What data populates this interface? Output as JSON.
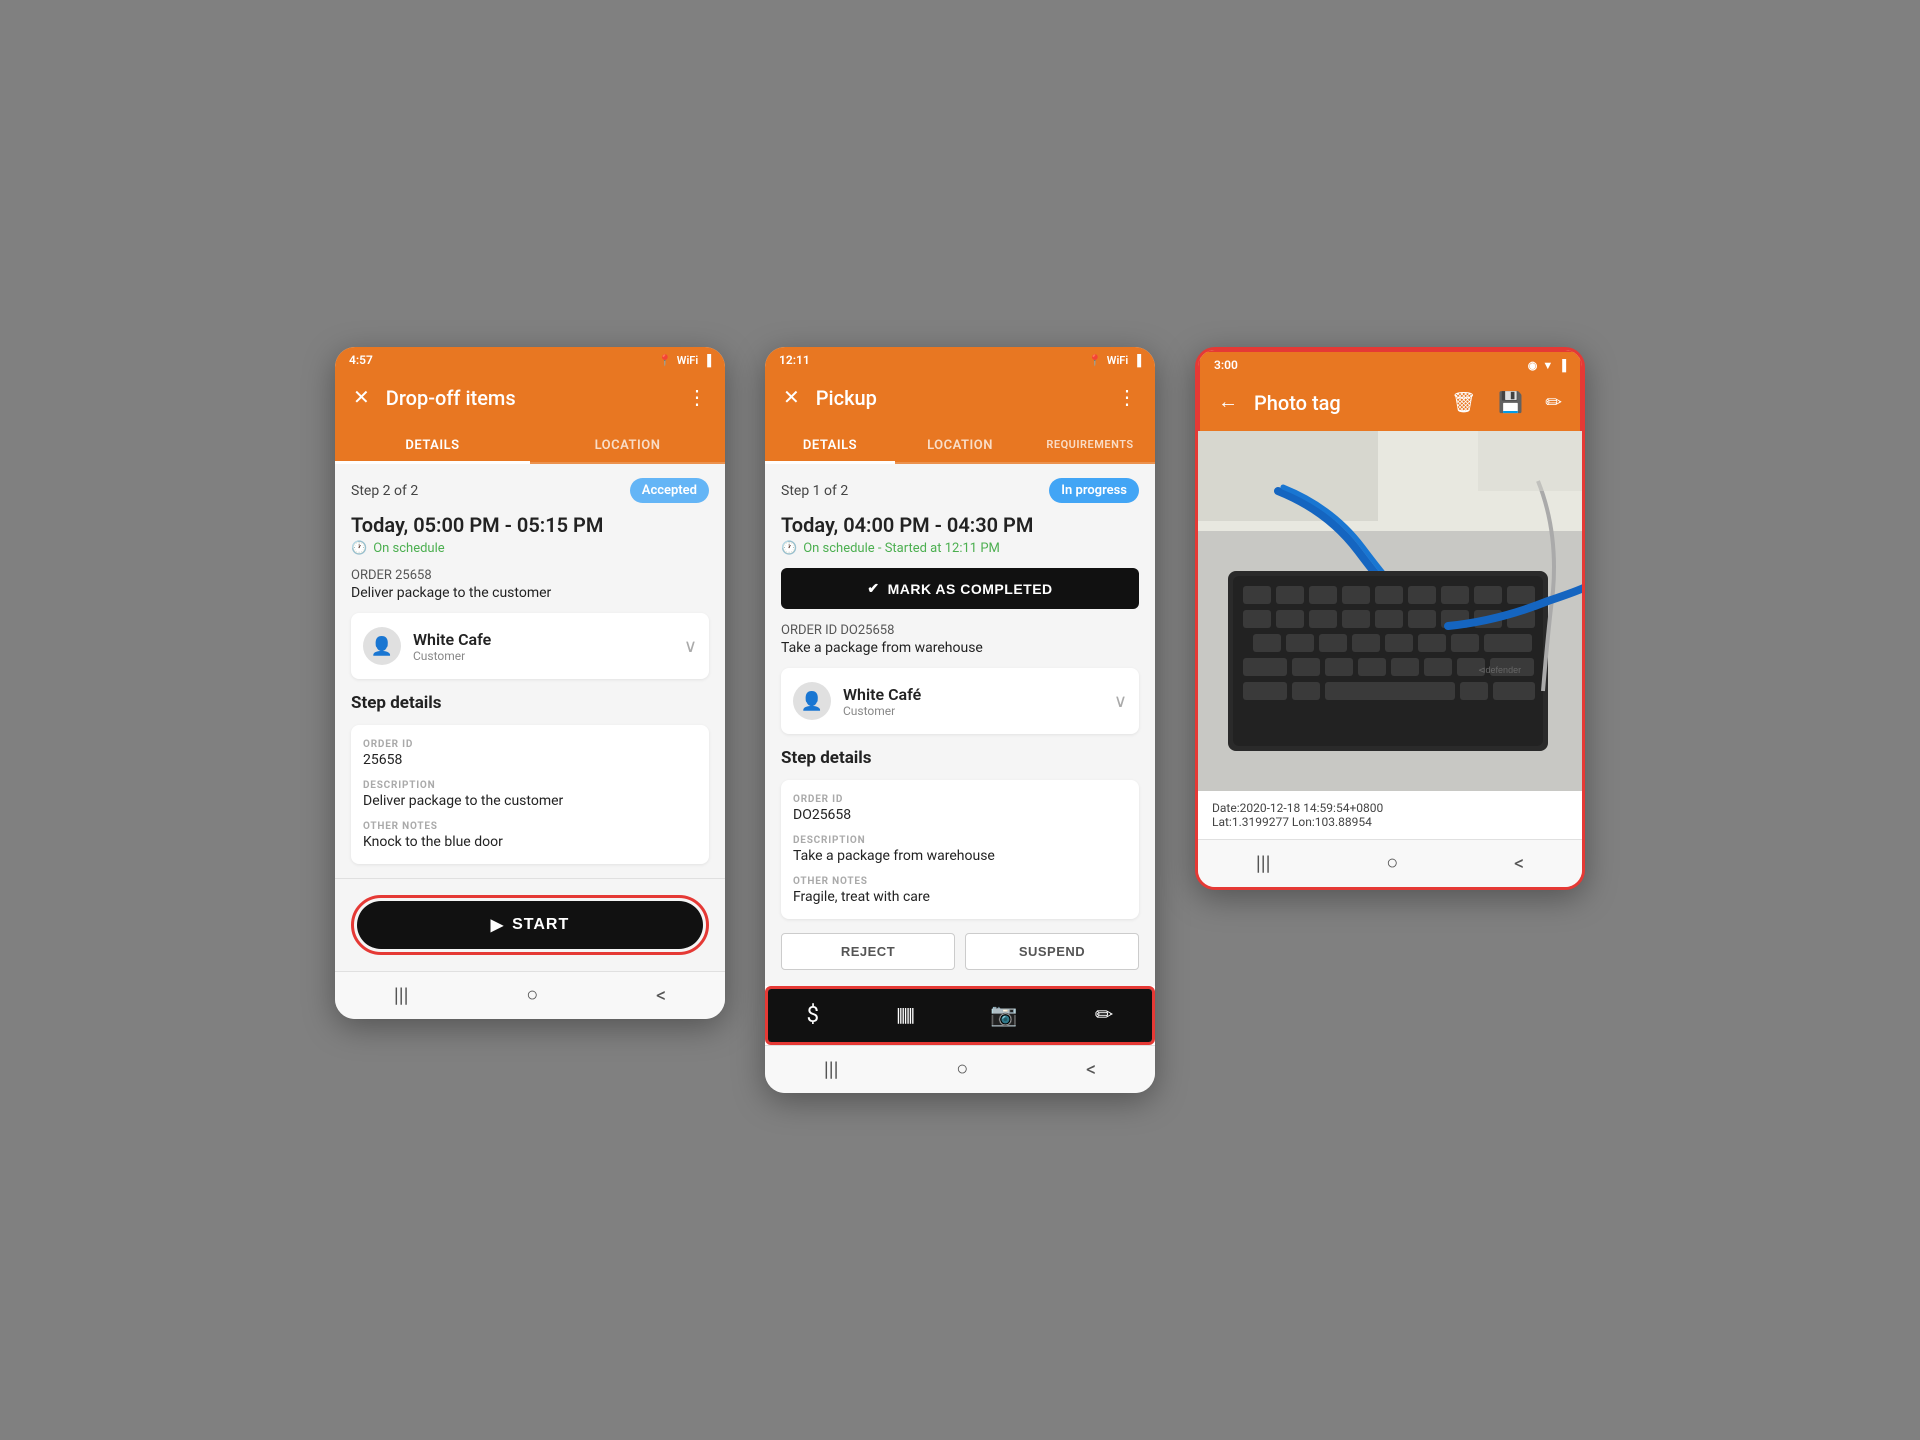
{
  "phone1": {
    "statusBar": {
      "time": "4:57",
      "icons": "▲ ◉ ·"
    },
    "header": {
      "title": "Drop-off items",
      "closeIcon": "✕",
      "menuIcon": "⋮"
    },
    "tabs": [
      {
        "label": "DETAILS",
        "active": true
      },
      {
        "label": "LOCATION",
        "active": false
      }
    ],
    "stepInfo": {
      "text": "Step 2 of 2",
      "badge": "Accepted"
    },
    "datetime": "Today, 05:00 PM - 05:15 PM",
    "schedule": "On schedule",
    "orderLabel": "ORDER 25658",
    "orderDesc": "Deliver package to the customer",
    "customer": {
      "name": "White Cafe",
      "role": "Customer"
    },
    "stepDetails": {
      "title": "Step details",
      "fields": [
        {
          "label": "ORDER ID",
          "value": "25658"
        },
        {
          "label": "DESCRIPTION",
          "value": "Deliver package to the customer"
        },
        {
          "label": "OTHER NOTES",
          "value": "Knock to the blue door"
        }
      ]
    },
    "startButton": "START",
    "nav": [
      "|||",
      "○",
      "<"
    ]
  },
  "phone2": {
    "statusBar": {
      "time": "12:11",
      "icons": "◉ ✉ ·"
    },
    "header": {
      "title": "Pickup",
      "closeIcon": "✕",
      "menuIcon": "⋮"
    },
    "tabs": [
      {
        "label": "DETAILS",
        "active": true
      },
      {
        "label": "LOCATION",
        "active": false
      },
      {
        "label": "REQUIREMENTS",
        "active": false
      }
    ],
    "stepInfo": {
      "text": "Step 1 of 2",
      "badge": "In progress"
    },
    "datetime": "Today, 04:00 PM - 04:30 PM",
    "schedule": "On schedule - Started at 12:11 PM",
    "markCompleted": "MARK AS COMPLETED",
    "orderIdLabel": "ORDER ID DO25658",
    "orderDesc": "Take a package from warehouse",
    "customer": {
      "name": "White Café",
      "role": "Customer"
    },
    "stepDetails": {
      "title": "Step details",
      "fields": [
        {
          "label": "ORDER ID",
          "value": "DO25658"
        },
        {
          "label": "DESCRIPTION",
          "value": "Take a package from warehouse"
        },
        {
          "label": "OTHER NOTES",
          "value": "Fragile, treat with care"
        }
      ]
    },
    "rejectBtn": "REJECT",
    "suspendBtn": "SUSPEND",
    "actionIcons": [
      "$",
      "|||",
      "📷",
      "✏"
    ],
    "nav": [
      "|||",
      "○",
      "<"
    ]
  },
  "phone3": {
    "statusBar": {
      "time": "3:00",
      "icons": "◉ · ▼"
    },
    "header": {
      "title": "Photo tag",
      "backIcon": "←",
      "deleteIcon": "🗑",
      "saveIcon": "💾",
      "editIcon": "✏"
    },
    "photoMeta": {
      "date": "Date:2020-12-18 14:59:54+0800",
      "lat": "Lat:1.3199277 Lon:103.88954"
    },
    "nav": [
      "|||",
      "○",
      "<"
    ]
  }
}
